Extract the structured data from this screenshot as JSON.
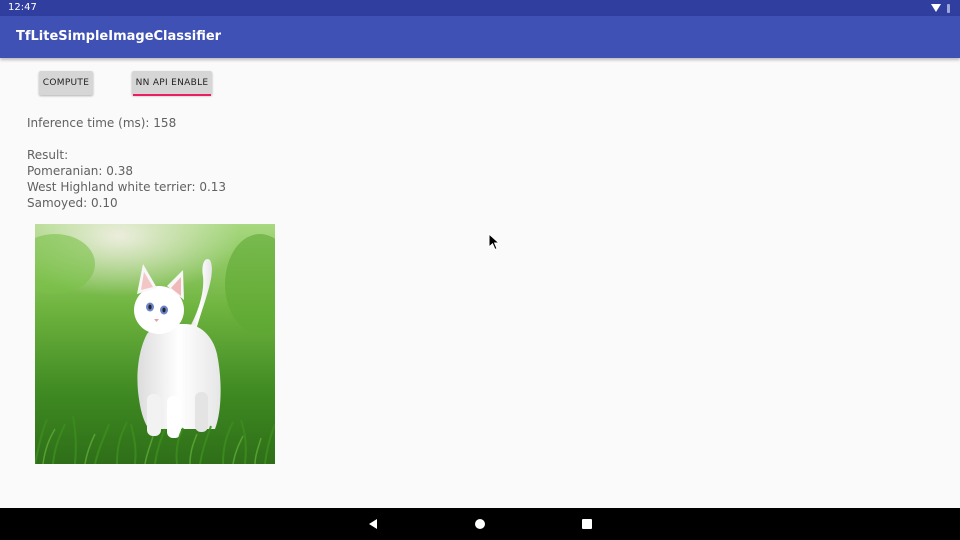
{
  "status_bar": {
    "time": "12:47"
  },
  "app_bar": {
    "title": "TfLiteSimpleImageClassifier"
  },
  "buttons": {
    "compute": "COMPUTE",
    "nnapi": "NN API ENABLE"
  },
  "inference": {
    "text": "Inference time (ms): 158"
  },
  "result": {
    "header": "Result:",
    "lines": [
      "Pomeranian: 0.38",
      "West Highland white terrier: 0.13",
      "Samoyed: 0.10"
    ]
  },
  "icons": {
    "status": [
      "wifi-icon",
      "battery-icon"
    ],
    "nav": [
      "back-icon",
      "home-icon",
      "recents-icon"
    ]
  },
  "colors": {
    "status_bar": "#303f9f",
    "app_bar": "#3f51b5",
    "accent": "#e91e63",
    "background": "#fafafa"
  }
}
